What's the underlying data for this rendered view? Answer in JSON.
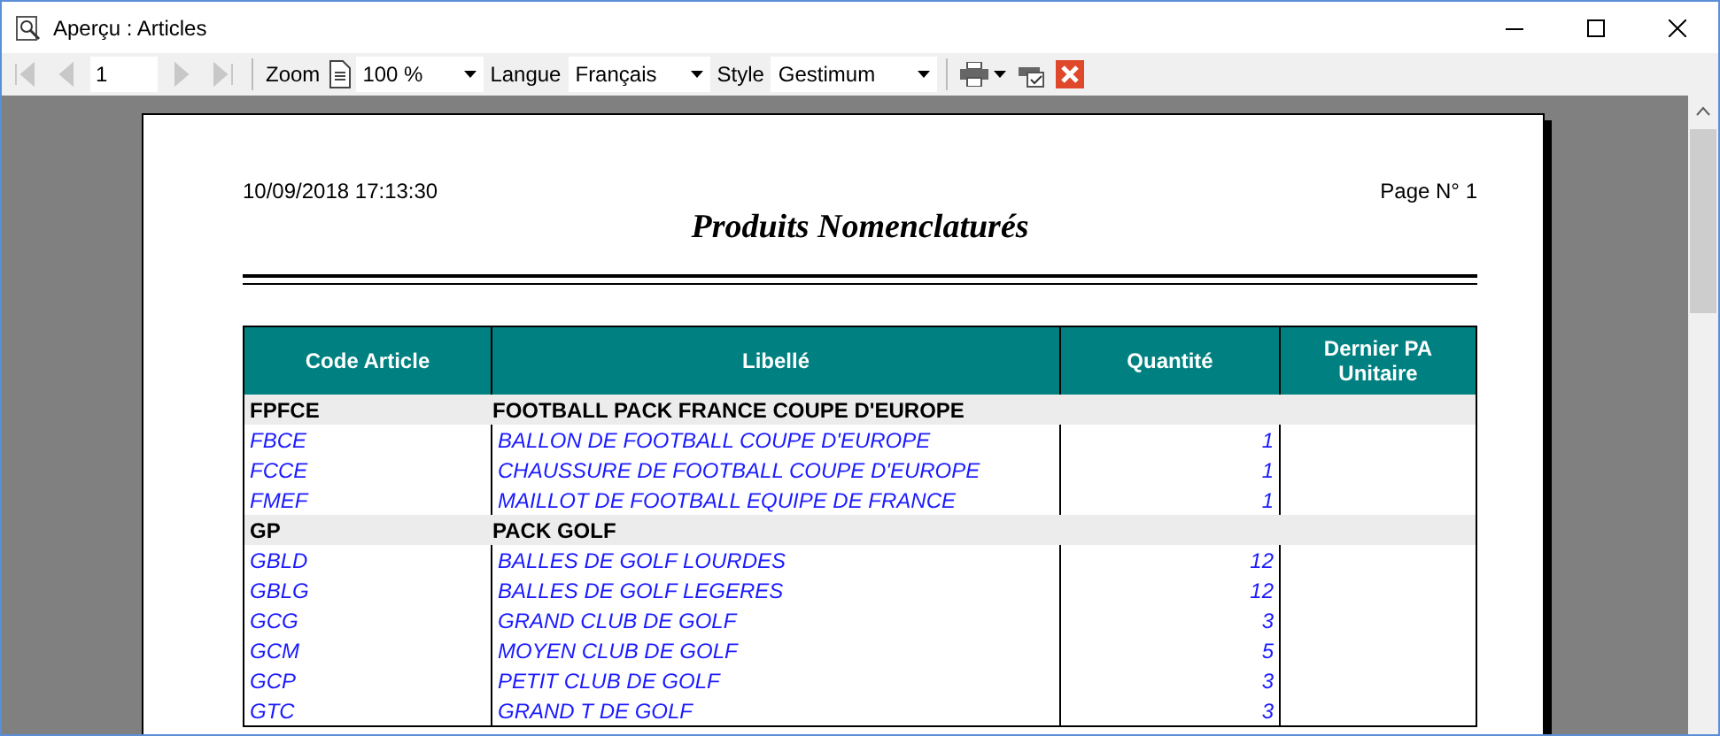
{
  "window": {
    "title": "Aperçu : Articles"
  },
  "toolbar": {
    "nav": [
      {
        "kind": "first",
        "disabled": true
      },
      {
        "kind": "prev",
        "disabled": true
      },
      {
        "kind": "next",
        "disabled": true
      },
      {
        "kind": "last",
        "disabled": true
      }
    ],
    "page": "1",
    "zoom_label": "Zoom",
    "zoom": "100 %",
    "language_label": "Langue",
    "language": "Français",
    "style_label": "Style",
    "style": "Gestimum"
  },
  "report": {
    "date": "10/09/2018 17:13:30",
    "page": "Page N° 1",
    "title": "Produits Nomenclaturés",
    "columns": [
      "Code Article",
      "Libellé",
      "Quantité",
      "Dernier PA Unitaire"
    ],
    "groups": [
      {
        "code": "FPFCE",
        "label": "FOOTBALL PACK FRANCE COUPE D'EUROPE",
        "items": [
          {
            "code": "FBCE",
            "label": "BALLON DE FOOTBALL COUPE D'EUROPE",
            "quantity": "1"
          },
          {
            "code": "FCCE",
            "label": "CHAUSSURE DE FOOTBALL COUPE D'EUROPE",
            "quantity": "1"
          },
          {
            "code": "FMEF",
            "label": "MAILLOT DE FOOTBALL EQUIPE DE FRANCE",
            "quantity": "1"
          }
        ]
      },
      {
        "code": "GP",
        "label": "PACK GOLF",
        "items": [
          {
            "code": "GBLD",
            "label": "BALLES DE GOLF LOURDES",
            "quantity": "12"
          },
          {
            "code": "GBLG",
            "label": "BALLES DE GOLF LEGERES",
            "quantity": "12"
          },
          {
            "code": "GCG",
            "label": "GRAND CLUB DE GOLF",
            "quantity": "3"
          },
          {
            "code": "GCM",
            "label": "MOYEN CLUB DE GOLF",
            "quantity": "5"
          },
          {
            "code": "GCP",
            "label": "PETIT CLUB DE GOLF",
            "quantity": "3"
          },
          {
            "code": "GTC",
            "label": "GRAND T DE GOLF",
            "quantity": "3"
          }
        ]
      }
    ]
  }
}
